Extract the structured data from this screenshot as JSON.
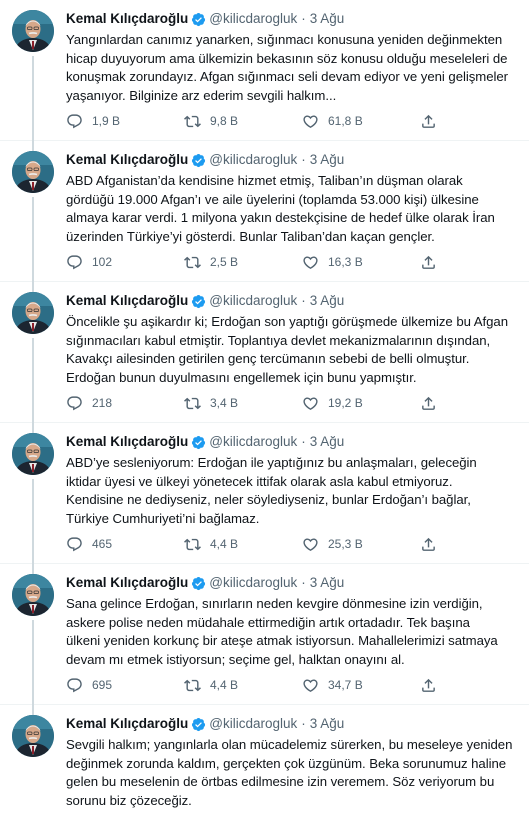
{
  "colors": {
    "text": "#0f1419",
    "muted": "#536471",
    "verified": "#1d9bf0",
    "divider": "#eff3f4"
  },
  "icons": {
    "reply": "reply-icon",
    "retweet": "retweet-icon",
    "like": "heart-icon",
    "share": "share-icon",
    "verified": "verified-badge-icon"
  },
  "tweets": [
    {
      "name": "Kemal Kılıçdaroğlu",
      "handle": "@kilicdarogluk",
      "dot": "·",
      "time": "3 Ağu",
      "text": "Yangınlardan canımız yanarken, sığınmacı konusuna yeniden değinmekten\nhicap duyuyorum ama ülkemizin bekasının söz konusu olduğu meseleleri de\nkonuşmak zorundayız. Afgan sığınmacı seli devam ediyor ve yeni gelişmeler\nyaşanıyor. Bilginize arz ederim sevgili halkım...",
      "replies": "1,9 B",
      "retweets": "9,8 B",
      "likes": "61,8 B"
    },
    {
      "name": "Kemal Kılıçdaroğlu",
      "handle": "@kilicdarogluk",
      "dot": "·",
      "time": "3 Ağu",
      "text": "ABD Afganistan’da kendisine hizmet etmiş, Taliban’ın düşman olarak\ngördüğü 19.000 Afgan’ı ve aile üyelerini (toplamda 53.000 kişi) ülkesine\nalmaya karar verdi. 1 milyona yakın destekçisine de hedef ülke olarak İran\nüzerinden Türkiye’yi gösterdi. Bunlar Taliban’dan kaçan gençler.",
      "replies": "102",
      "retweets": "2,5 B",
      "likes": "16,3 B"
    },
    {
      "name": "Kemal Kılıçdaroğlu",
      "handle": "@kilicdarogluk",
      "dot": "·",
      "time": "3 Ağu",
      "text": "Öncelikle şu aşikardır ki; Erdoğan son yaptığı görüşmede ülkemize bu Afgan\nsığınmacıları kabul etmiştir. Toplantıya devlet mekanizmalarının dışından,\nKavakçı ailesinden getirilen genç tercümanın sebebi de belli olmuştur.\nErdoğan bunun duyulmasını engellemek için bunu yapmıştır.",
      "replies": "218",
      "retweets": "3,4 B",
      "likes": "19,2 B"
    },
    {
      "name": "Kemal Kılıçdaroğlu",
      "handle": "@kilicdarogluk",
      "dot": "·",
      "time": "3 Ağu",
      "text": "ABD’ye sesleniyorum: Erdoğan ile yaptığınız bu anlaşmaları, geleceğin\niktidar üyesi ve ülkeyi yönetecek ittifak olarak asla kabul etmiyoruz.\nKendisine ne dediyseniz, neler söylediyseniz, bunlar Erdoğan’ı bağlar,\nTürkiye Cumhuriyeti’ni bağlamaz.",
      "replies": "465",
      "retweets": "4,4 B",
      "likes": "25,3 B"
    },
    {
      "name": "Kemal Kılıçdaroğlu",
      "handle": "@kilicdarogluk",
      "dot": "·",
      "time": "3 Ağu",
      "text": "Sana gelince Erdoğan, sınırların neden kevgire dönmesine izin verdiğin,\naskere polise neden müdahale ettirmediğin artık ortadadır. Tek başına\nülkeni yeniden korkunç bir ateşe atmak istiyorsun. Mahallelerimizi satmaya\ndevam mı etmek istiyorsun; seçime gel, halktan onayını al.",
      "replies": "695",
      "retweets": "4,4 B",
      "likes": "34,7 B"
    },
    {
      "name": "Kemal Kılıçdaroğlu",
      "handle": "@kilicdarogluk",
      "dot": "·",
      "time": "3 Ağu",
      "text": "Sevgili halkım; yangınlarla olan mücadelemiz sürerken, bu meseleye yeniden\ndeğinmek zorunda kaldım, gerçekten çok üzgünüm. Beka sorunumuz haline\ngelen bu meselenin de örtbas edilmesine izin veremem. Söz veriyorum bu\nsorunu biz çözeceğiz."
    }
  ]
}
